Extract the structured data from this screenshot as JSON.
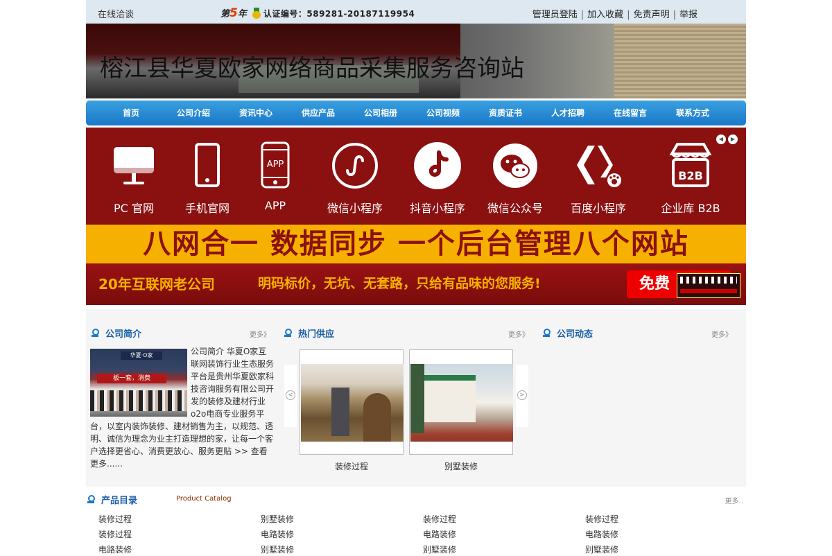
{
  "topbar": {
    "online": "在线洽谈",
    "year_prefix": "第",
    "year_num": "5",
    "year_suffix": "年",
    "cert_label": "认证编号：589281-20187119954",
    "links": [
      "管理员登陆",
      "加入收藏",
      "免责声明",
      "举报"
    ]
  },
  "banner": {
    "title": "榕江县华夏欧家网络商品采集服务咨询站"
  },
  "nav": [
    "首页",
    "公司介绍",
    "资讯中心",
    "供应产品",
    "公司相册",
    "公司视频",
    "资质证书",
    "人才招聘",
    "在线留言",
    "联系方式"
  ],
  "promo": {
    "items": [
      {
        "label": "PC 官网",
        "icon": "desktop-icon"
      },
      {
        "label": "手机官网",
        "icon": "mobile-icon"
      },
      {
        "label": "APP",
        "icon": "app-icon"
      },
      {
        "label": "微信小程序",
        "icon": "wechat-miniprogram-icon"
      },
      {
        "label": "抖音小程序",
        "icon": "douyin-icon"
      },
      {
        "label": "微信公众号",
        "icon": "wechat-icon"
      },
      {
        "label": "百度小程序",
        "icon": "baidu-icon"
      },
      {
        "label": "企业库 B2B",
        "icon": "b2b-store-icon"
      }
    ],
    "app_icon_text": "APP",
    "b2b_icon_text": "B2B",
    "slogan1": "八网合一  数据同步  一个后台管理八个网站",
    "slogan2a": "20年互联网老公司",
    "slogan2b": "明码标价，无坑、无套路，只给有品味的您服务!",
    "free": "免费"
  },
  "intro": {
    "title": "公司简介",
    "more": "更多》",
    "text": "公司简介 华夏O家互联网装饰行业生态服务平台是贵州华夏欧家科技咨询服务有限公司开发的装修及建材行业o2o电商专业服务平台，以室内装饰装修、建材销售为主，以规范、透明、诚信为理念为业主打造理想的家，让每一个客户选择更省心、消费更放心、服务更贴 >> 查看更多......",
    "image_sign": "华夏·O家",
    "image_banner": "板一套，消费"
  },
  "supply": {
    "title": "热门供应",
    "more": "更多》",
    "items": [
      {
        "caption": "装修过程"
      },
      {
        "caption": "别墅装修"
      }
    ]
  },
  "news": {
    "title": "公司动态",
    "more": "更多》"
  },
  "catalog": {
    "title": "产品目录",
    "en": "Product Catalog",
    "more": "更多..",
    "rows": [
      [
        "装修过程",
        "别墅装修",
        "装修过程",
        "装修过程"
      ],
      [
        "装修过程",
        "电路装修",
        "电路装修",
        "电路装修"
      ],
      [
        "电路装修",
        "别墅装修",
        "别墅装修",
        "别墅装修"
      ]
    ]
  }
}
